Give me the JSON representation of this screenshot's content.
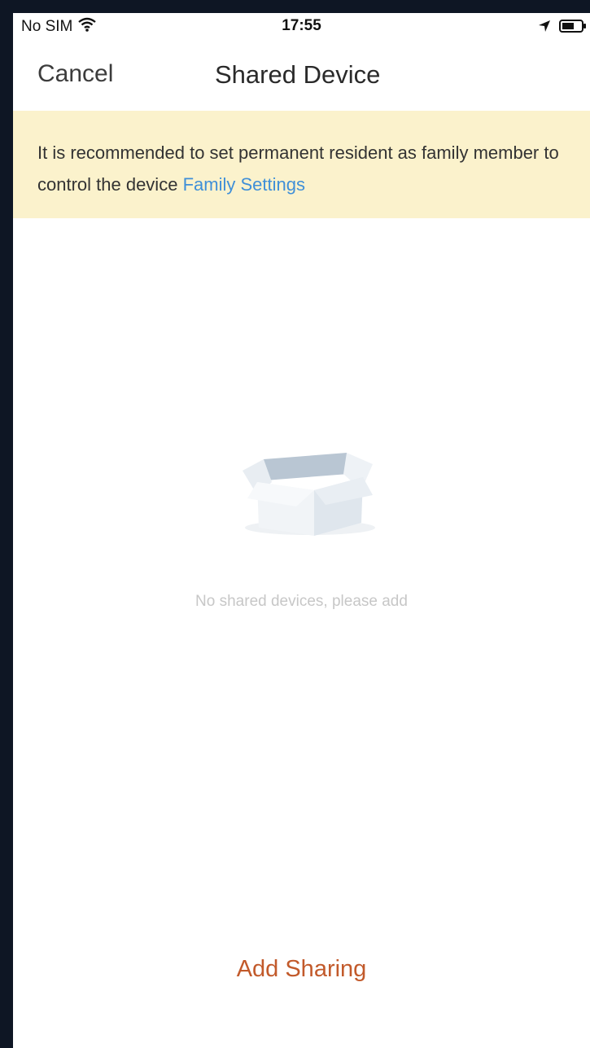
{
  "status_bar": {
    "carrier": "No SIM",
    "time": "17:55"
  },
  "nav": {
    "cancel_label": "Cancel",
    "title": "Shared Device"
  },
  "banner": {
    "message": "It is recommended to set permanent resident as family member to control the device",
    "link_label": "Family Settings"
  },
  "empty_state": {
    "message": "No shared devices, please add"
  },
  "footer": {
    "add_sharing_label": "Add Sharing"
  },
  "colors": {
    "banner_bg": "#fbf2cc",
    "link": "#3f8fd8",
    "accent": "#c25a2b"
  },
  "icons": [
    "wifi-icon",
    "location-arrow-icon",
    "battery-icon",
    "empty-box-icon"
  ]
}
